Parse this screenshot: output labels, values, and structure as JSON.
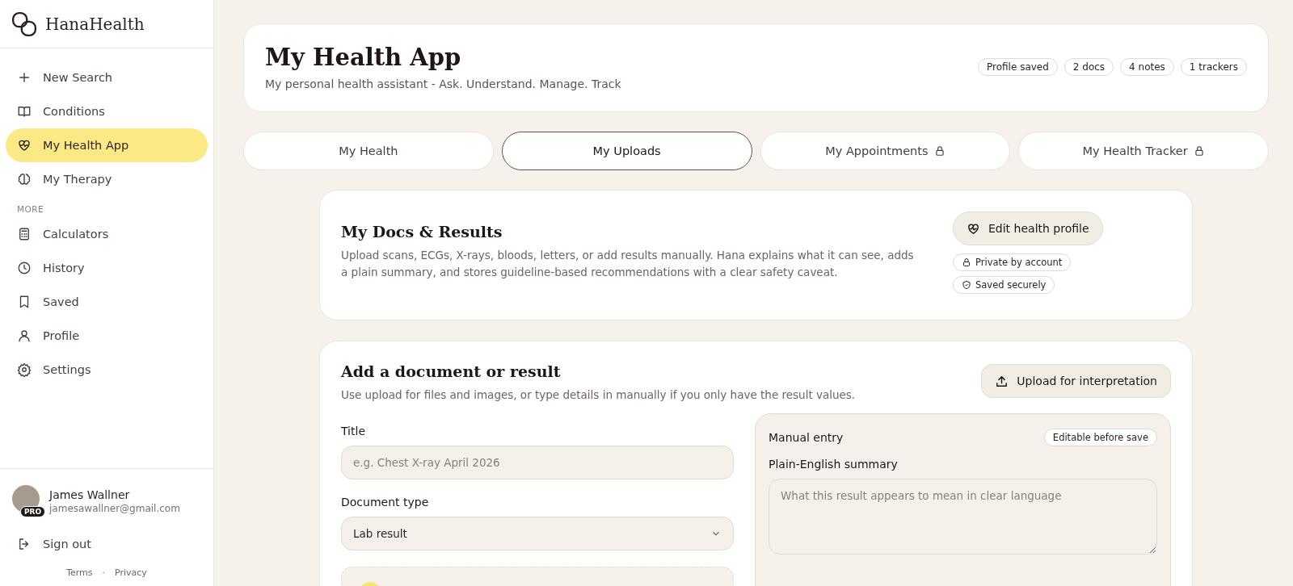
{
  "sidebar": {
    "brand": "HanaHealth",
    "nav": [
      {
        "label": "New Search",
        "selected": false
      },
      {
        "label": "Conditions",
        "selected": false
      },
      {
        "label": "My Health App",
        "selected": true
      },
      {
        "label": "My Therapy",
        "selected": false
      }
    ],
    "section_label": "MORE",
    "more": [
      {
        "label": "Calculators",
        "selected": false
      },
      {
        "label": "History",
        "selected": false
      },
      {
        "label": "Saved",
        "selected": false
      },
      {
        "label": "Profile",
        "selected": false
      },
      {
        "label": "Settings",
        "selected": false
      }
    ],
    "user": {
      "name": "James Wallner",
      "email": "jamesawallner@gmail.com",
      "badge": "PRO"
    },
    "sign_out": "Sign out",
    "footer_links": [
      "Terms",
      "Privacy"
    ],
    "footer_separator": "·"
  },
  "header": {
    "title": "My Health App",
    "subtitle": "My personal health assistant - Ask. Understand. Manage. Track",
    "chips": [
      "Profile saved",
      "2 docs",
      "4 notes",
      "1 trackers"
    ]
  },
  "tabs": [
    {
      "label": "My Health",
      "selected": false,
      "locked": false
    },
    {
      "label": "My Uploads",
      "selected": true,
      "locked": false
    },
    {
      "label": "My Appointments",
      "selected": false,
      "locked": true
    },
    {
      "label": "My Health Tracker",
      "selected": false,
      "locked": true
    }
  ],
  "docs_card": {
    "title": "My Docs & Results",
    "description": "Upload scans, ECGs, X-rays, bloods, letters, or add results manually. Hana explains what it can see, adds a plain summary, and stores guideline-based recommendations with a clear safety caveat.",
    "button": "Edit health profile",
    "chips": [
      "Private by account",
      "Saved securely"
    ]
  },
  "add_card": {
    "title": "Add a document or result",
    "description": "Use upload for files and images, or type details in manually if you only have the result values.",
    "button": "Upload for interpretation",
    "title_field": {
      "label": "Title",
      "placeholder": "e.g. Chest X-ray April 2026"
    },
    "type_field": {
      "label": "Document type",
      "value": "Lab result"
    },
    "manual": {
      "heading": "Manual entry",
      "chip": "Editable before save",
      "summary_label": "Plain-English summary",
      "summary_placeholder": "What this result appears to mean in clear language"
    }
  }
}
